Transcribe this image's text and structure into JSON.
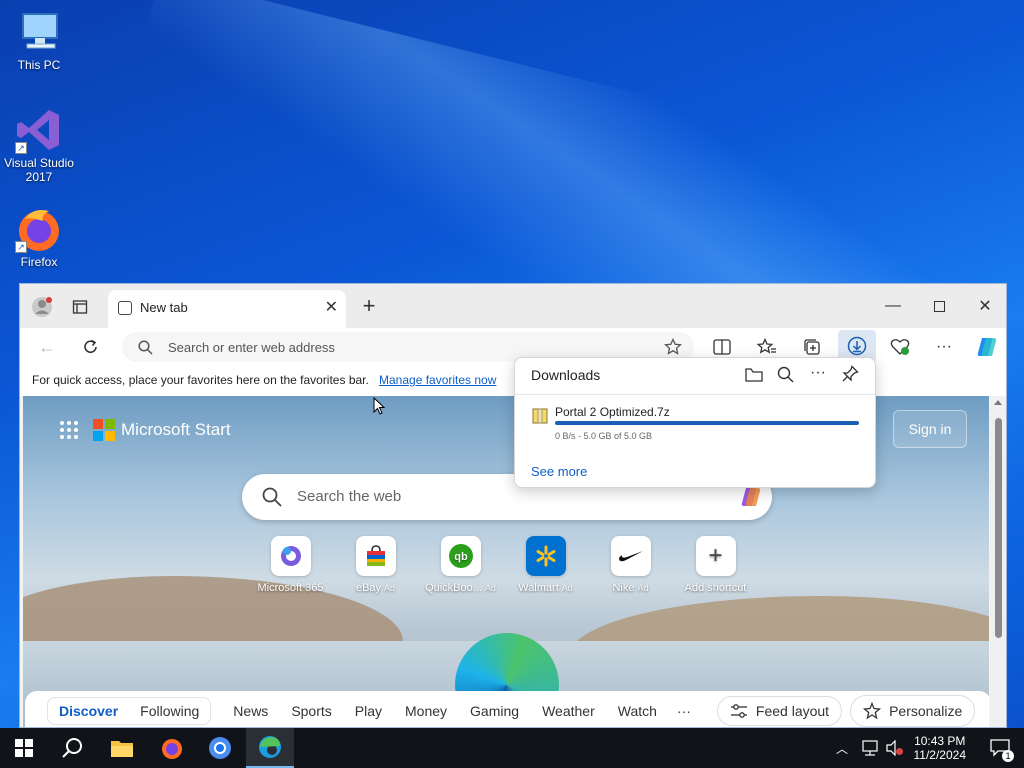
{
  "desktop": {
    "icons": [
      {
        "label": "This PC"
      },
      {
        "label": "Visual Studio 2017"
      },
      {
        "label": "Firefox"
      }
    ]
  },
  "browser": {
    "tab_title": "New tab",
    "address_placeholder": "Search or enter web address",
    "favorites_bar_text": "For quick access, place your favorites here on the favorites bar.",
    "favorites_link": "Manage favorites now"
  },
  "newtab": {
    "brand": "Microsoft Start",
    "sign_in": "Sign in",
    "search_placeholder": "Search the web",
    "shortcuts": [
      {
        "label": "Microsoft 365",
        "ad": ""
      },
      {
        "label": "eBay",
        "ad": "Ad"
      },
      {
        "label": "QuickBoo...",
        "ad": "Ad"
      },
      {
        "label": "Walmart",
        "ad": "Ad"
      },
      {
        "label": "Nike",
        "ad": "Ad"
      },
      {
        "label": "Add shortcut",
        "ad": ""
      }
    ],
    "feed_tabs": [
      "Discover",
      "Following",
      "News",
      "Sports",
      "Play",
      "Money",
      "Gaming",
      "Weather",
      "Watch",
      "···"
    ],
    "feed_layout": "Feed layout",
    "personalize": "Personalize"
  },
  "downloads": {
    "title": "Downloads",
    "file_name": "Portal 2 Optimized.7z",
    "progress": 1.0,
    "status": "0 B/s - 5.0 GB of 5.0 GB",
    "see_more": "See more"
  },
  "taskbar": {
    "time": "10:43 PM",
    "date": "11/2/2024",
    "notification_count": "1"
  }
}
